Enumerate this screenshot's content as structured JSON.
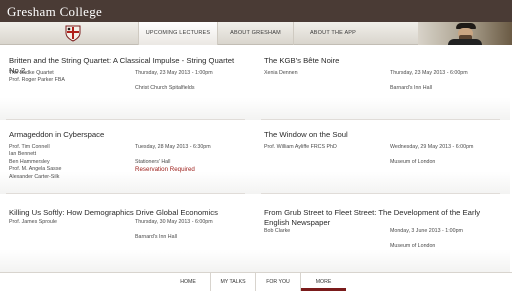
{
  "app": {
    "brand": "Gresham College"
  },
  "tabs": [
    {
      "label": "UPCOMING LECTURES",
      "active": true
    },
    {
      "label": "ABOUT GRESHAM",
      "active": false
    },
    {
      "label": "ABOUT THE APP",
      "active": false
    }
  ],
  "lectures": [
    {
      "title": "Britten and the String Quartet: A Classical Impulse - String Quartet No.2",
      "speakers": [
        "The Badke Quartet",
        "Prof. Roger Parker FBA"
      ],
      "date": "Thursday, 23 May 2013 - 1:00pm",
      "venue": "Christ Church Spitalfields"
    },
    {
      "title": "The KGB's Bête Noire",
      "speakers": [
        "Xenia Dennen"
      ],
      "date": "Thursday, 23 May 2013 - 6:00pm",
      "venue": "Barnard's Inn Hall"
    },
    {
      "title": "Armageddon in Cyberspace",
      "speakers": [
        "Prof. Tim Connell",
        "Ian Bennett",
        "Ben Hammersley",
        "Prof. M. Angela Sasse",
        "Alexander Carter-Silk"
      ],
      "date": "Tuesday, 28 May 2013 - 6:30pm",
      "venue": "Stationers' Hall",
      "reservation": "Reservation Required"
    },
    {
      "title": "The Window on the Soul",
      "speakers": [
        "Prof. William Ayliffe FRCS PhD"
      ],
      "date": "Wednesday, 29 May 2013 - 6:00pm",
      "venue": "Museum of London"
    },
    {
      "title": "Killing Us Softly: How Demographics Drive Global Economics",
      "speakers": [
        "Prof. James Sproule"
      ],
      "date": "Thursday, 30 May 2013 - 6:00pm",
      "venue": "Barnard's Inn Hall"
    },
    {
      "title": "From Grub Street to Fleet Street: The Development of the Early English Newspaper",
      "speakers": [
        "Bob Clarke"
      ],
      "date": "Monday, 3 June 2013 - 1:00pm",
      "venue": "Museum of London"
    }
  ],
  "bottom_nav": [
    {
      "label": "HOME",
      "active": false
    },
    {
      "label": "MY TALKS",
      "active": false
    },
    {
      "label": "FOR YOU",
      "active": false
    },
    {
      "label": "MORE",
      "active": true
    }
  ],
  "colors": {
    "header": "#4a3b35",
    "accent": "#9b1b17",
    "active_tab_underline": "#7a1b1b"
  }
}
